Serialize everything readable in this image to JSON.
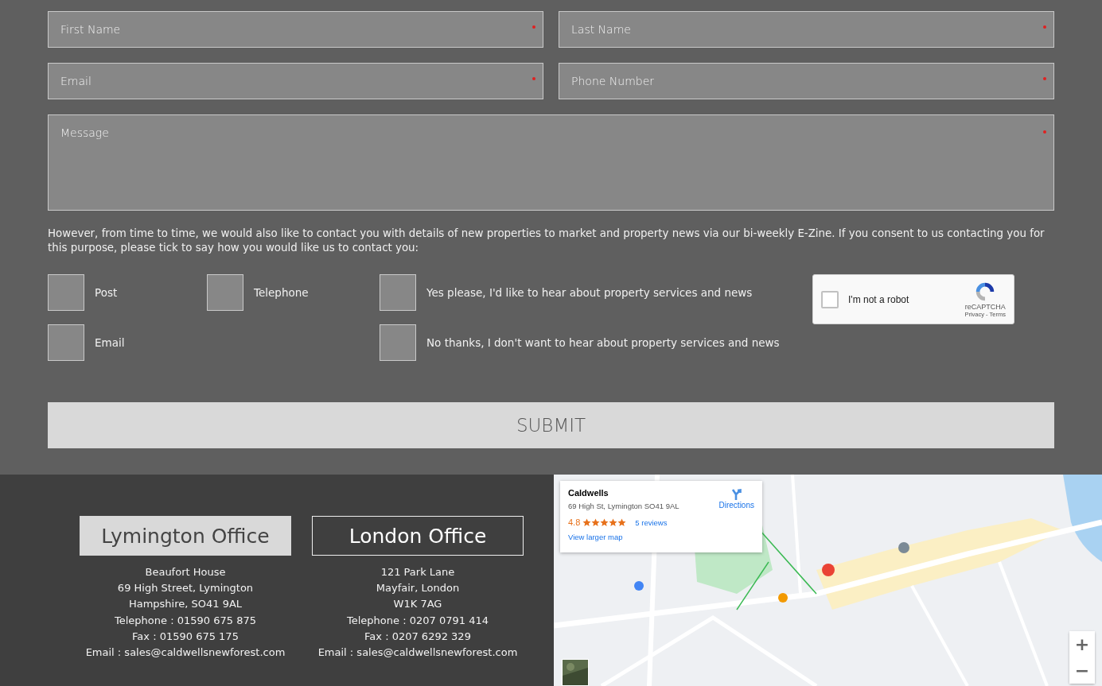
{
  "form": {
    "fields": [
      {
        "kind": "input",
        "placeholder": "First Name",
        "required": true
      },
      {
        "kind": "input",
        "placeholder": "Last Name",
        "required": true
      },
      {
        "kind": "input",
        "placeholder": "Email",
        "required": true
      },
      {
        "kind": "input",
        "placeholder": "Phone Number",
        "required": true
      },
      {
        "kind": "textarea",
        "placeholder": "Message",
        "required": true
      }
    ],
    "consent_text": "However, from time to time, we would also like to contact you with details of new properties to market and property news via our bi-weekly E-Zine. If you consent to us contacting you for this purpose, please tick to say how you would like us to contact you:",
    "contact_methods": [
      {
        "label": "Post",
        "checked": false
      },
      {
        "label": "Telephone",
        "checked": false
      },
      {
        "label": "Email",
        "checked": false
      }
    ],
    "preferences": [
      {
        "label": "Yes please, I'd like to hear about property services and news",
        "checked": false
      },
      {
        "label": "No thanks, I don't want to hear about property services and news",
        "checked": false
      }
    ],
    "captcha": {
      "label": "I'm not a robot",
      "checked": false,
      "brand": "reCAPTCHA",
      "links": "Privacy - Terms"
    },
    "submit": "SUBMIT"
  },
  "offices": [
    {
      "title": "Lymington Office",
      "selected": true,
      "lines": [
        "Beaufort House",
        "69 High Street, Lymington",
        "Hampshire, SO41 9AL",
        "Telephone : 01590 675 875",
        "Fax : 01590 675 175",
        "Email : sales@caldwellsnewforest.com"
      ]
    },
    {
      "title": "London Office",
      "selected": false,
      "lines": [
        "121 Park Lane",
        "Mayfair, London",
        "W1K 7AG",
        "Telephone : 0207 0791 414",
        "Fax : 0207 6292 329",
        "Email : sales@caldwellsnewforest.com"
      ]
    }
  ],
  "map": {
    "card": {
      "name": "Caldwells",
      "address": "69 High St, Lymington SO41 9AL",
      "directions": "Directions",
      "rating": "4.8",
      "stars": 5,
      "reviews": "5 reviews",
      "link": "View larger map"
    },
    "zoom": [
      "+",
      "−"
    ]
  }
}
